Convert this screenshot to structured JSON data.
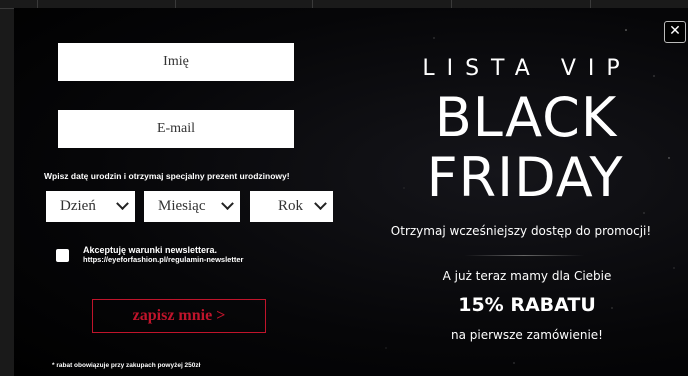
{
  "form": {
    "name_placeholder": "Imię",
    "email_placeholder": "E-mail",
    "birthday_label": "Wpisz datę urodzin i otrzymaj specjalny prezent urodzinowy!",
    "day_select": "Dzień",
    "month_select": "Miesiąc",
    "year_select": "Rok",
    "consent_text": "Akceptuję warunki newslettera.",
    "consent_url": "https://eyeforfashion.pl/regulamin-newsletter",
    "submit_label": "zapisz mnie >",
    "footnote": "* rabat obowiązuje przy zakupach powyżej 250zł"
  },
  "promo": {
    "vip_label": "LISTA VIP",
    "headline_line1": "BLACK",
    "headline_line2": "FRIDAY",
    "early_access": "Otrzymaj wcześniejszy dostęp do promocji!",
    "already_text": "A już teraz mamy dla Ciebie",
    "discount": "15% RABATU",
    "first_order": "na pierwsze zamówienie!"
  },
  "close_icon": "close-icon",
  "colors": {
    "accent": "#c0142b",
    "background": "#000000",
    "text": "#ffffff"
  }
}
